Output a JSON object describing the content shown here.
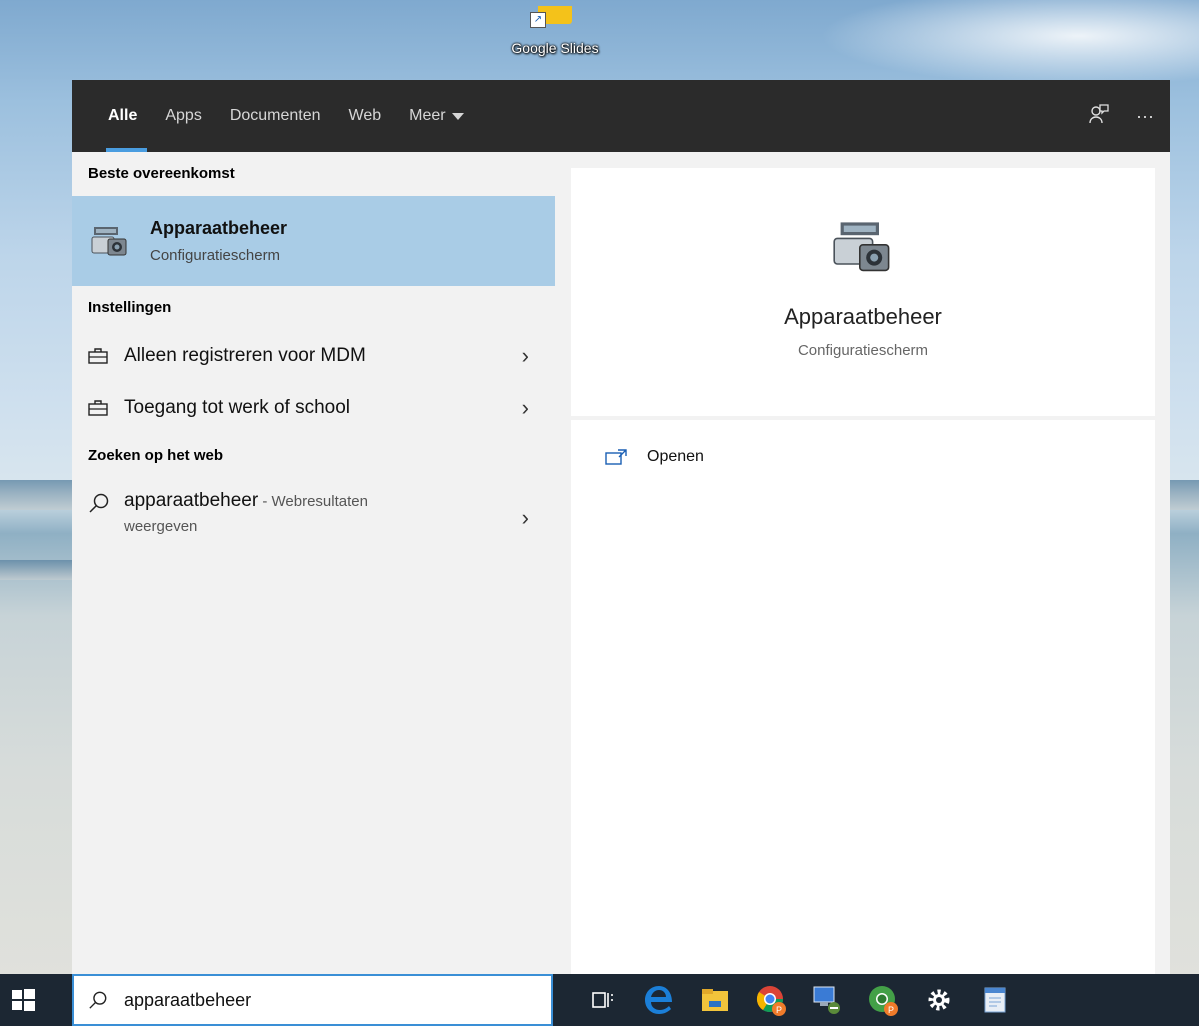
{
  "desktop": {
    "icon_label": "Google Slides"
  },
  "tabs": [
    {
      "label": "Alle",
      "active": true
    },
    {
      "label": "Apps"
    },
    {
      "label": "Documenten"
    },
    {
      "label": "Web"
    },
    {
      "label": "Meer"
    }
  ],
  "topbar_icons": [
    "feedback-icon",
    "more-options-icon"
  ],
  "left": {
    "best_match_header": "Beste overeenkomst",
    "best_match": {
      "title": "Apparaatbeheer",
      "subtitle": "Configuratiescherm",
      "icon": "device-manager-icon"
    },
    "settings_header": "Instellingen",
    "settings": [
      {
        "label": "Alleen registreren voor MDM",
        "icon": "briefcase-icon"
      },
      {
        "label": "Toegang tot werk of school",
        "icon": "briefcase-icon"
      }
    ],
    "web_header": "Zoeken op het web",
    "web": {
      "query": "apparaatbeheer",
      "suffix": " - Webresultaten",
      "line2": "weergeven"
    }
  },
  "right": {
    "title": "Apparaatbeheer",
    "subtitle": "Configuratiescherm",
    "actions": [
      {
        "label": "Openen",
        "icon": "open-icon"
      }
    ]
  },
  "taskbar": {
    "search_value": "apparaatbeheer",
    "apps": [
      "task-view-icon",
      "edge-icon",
      "file-explorer-icon",
      "chrome-icon",
      "remote-desktop-icon",
      "chrome-profile-icon",
      "settings-icon",
      "notepad-icon"
    ]
  },
  "colors": {
    "selected_highlight": "#a9cce6",
    "tab_accent": "#4a9de0",
    "topbar": "#2b2b2b",
    "taskbar": "#1c2733"
  }
}
